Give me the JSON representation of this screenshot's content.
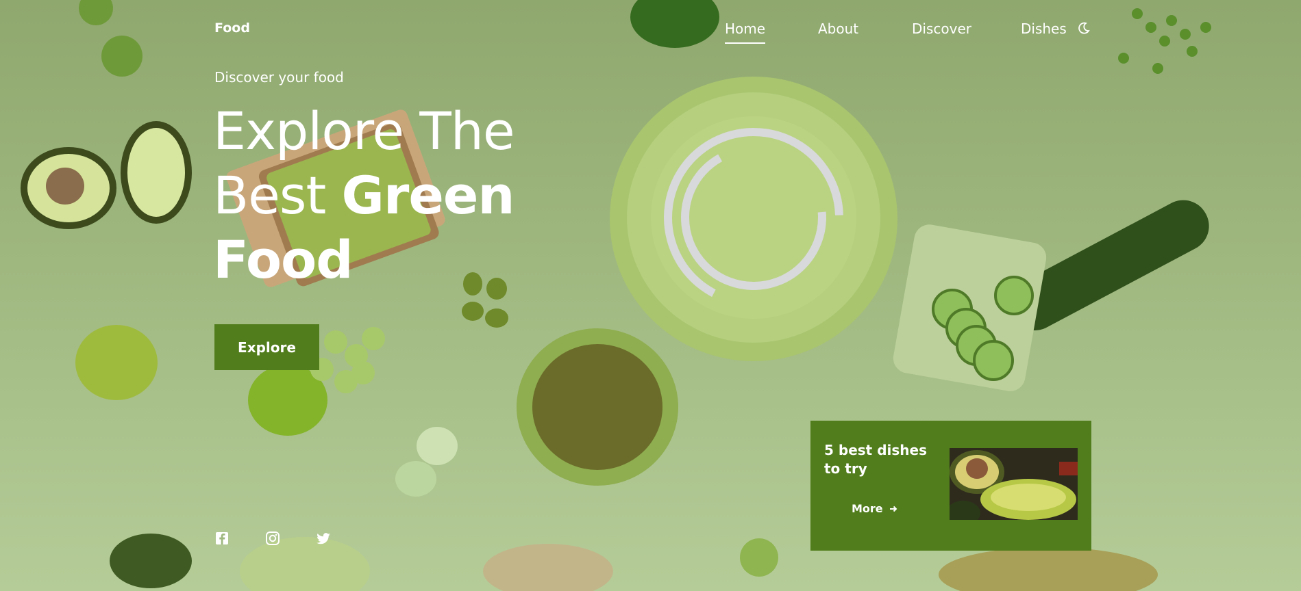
{
  "header": {
    "logo": "Food",
    "nav": [
      {
        "label": "Home",
        "active": true
      },
      {
        "label": "About",
        "active": false
      },
      {
        "label": "Discover",
        "active": false
      },
      {
        "label": "Dishes",
        "active": false
      }
    ],
    "theme_toggle_icon": "moon-icon"
  },
  "hero": {
    "subtitle": "Discover your food",
    "title_line1": "Explore The",
    "title_line2_regular": "Best ",
    "title_line2_bold": "Green",
    "title_line3_bold": "Food",
    "cta_label": "Explore"
  },
  "social": [
    "facebook-icon",
    "instagram-icon",
    "twitter-icon"
  ],
  "card": {
    "title": "5 best dishes to try",
    "more_label": "More",
    "more_icon": "arrow-right-icon"
  },
  "colors": {
    "accent": "#517d1c",
    "background": "#9fb880"
  }
}
